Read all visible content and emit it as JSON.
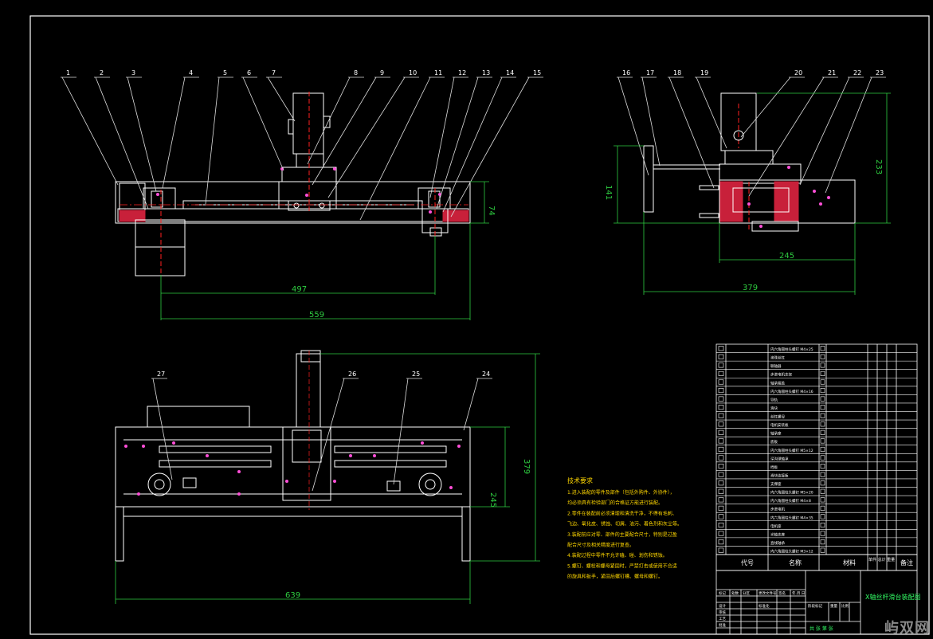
{
  "drawing": {
    "colors": {
      "background": "#000000",
      "line": "#ffffff",
      "center_line": "#ff2020",
      "dimension": "#2ecc40",
      "leader": "#e0e0e0",
      "text": "#ffffff",
      "notes": "#ffd700",
      "title_text": "#33ff66"
    },
    "front_view": {
      "balloons": [
        "1",
        "2",
        "3",
        "4",
        "5",
        "6",
        "7",
        "8",
        "9",
        "10",
        "11",
        "12",
        "13",
        "14",
        "15"
      ],
      "dimensions": {
        "height": "74",
        "stroke": "497",
        "overall": "559"
      }
    },
    "side_view": {
      "balloons": [
        "16",
        "17",
        "18",
        "19",
        "20",
        "21",
        "22",
        "23"
      ],
      "dimensions": {
        "height_left": "141",
        "height_right": "233",
        "width_inner": "245",
        "width_total": "379"
      }
    },
    "top_view": {
      "balloons": [
        "27",
        "26",
        "25",
        "24"
      ],
      "dimensions": {
        "depth_inner": "245",
        "depth_total": "379",
        "width": "639"
      }
    },
    "tech_notes": {
      "title": "技术要求",
      "lines": [
        "1.进入装配的零件及部件（包括外购件、外协件），",
        "均必须具有检验部门的合格证方能进行装配。",
        "2.零件在装配前必须清理和清洗干净，不得有毛刺、",
        "飞边、氧化皮、锈蚀、切屑、油污、着色剂和灰尘等。",
        "3.装配前应对零、部件的主要配合尺寸，特别是过盈",
        "配合尺寸及相关精度进行复查。",
        "4.装配过程中零件不允许磕、碰、划伤和锈蚀。",
        "5.螺钉、螺栓和螺母紧固时，严禁打击或使用不合适",
        "的旋具和扳手，紧固后螺钉槽、螺母和螺钉。"
      ]
    },
    "bom": {
      "rows": [
        "内六角圆柱头螺钉 M4×25",
        "滚珠丝杠",
        "联轴器",
        "步进电机支架",
        "轴承端盖",
        "内六角圆柱头螺钉 M4×16",
        "导轨",
        "滑块",
        "丝杠螺母",
        "电机安装板",
        "轴承座",
        "底板",
        "内六角圆柱头螺钉 M5×12",
        "深沟球轴承",
        "挡板",
        "滑块连接板",
        "支撑座",
        "内六角圆柱头螺钉 M5×20",
        "内六角圆柱头螺钉 M4×8",
        "步进电机",
        "内六角圆柱头螺钉 M4×35",
        "电机座",
        "光轴支座",
        "直线轴承",
        "内六角圆柱头螺钉 M3×12"
      ],
      "header": {
        "code": "代号",
        "name": "名称",
        "material": "材料",
        "mass": "单件 总计 重量",
        "remark": "备注"
      }
    },
    "title_block": {
      "drawing_name": "X轴丝杆滑台装配图",
      "roles": [
        "标记",
        "处数",
        "分区",
        "更改文件号",
        "签名",
        "年.月.日"
      ],
      "rows2": [
        "设计",
        "审核",
        "工艺",
        "批准"
      ],
      "labels": [
        "标准化",
        "阶段标记",
        "重量",
        "比例"
      ],
      "sheet": "共 张 第 张"
    },
    "watermark": "屿双网"
  }
}
